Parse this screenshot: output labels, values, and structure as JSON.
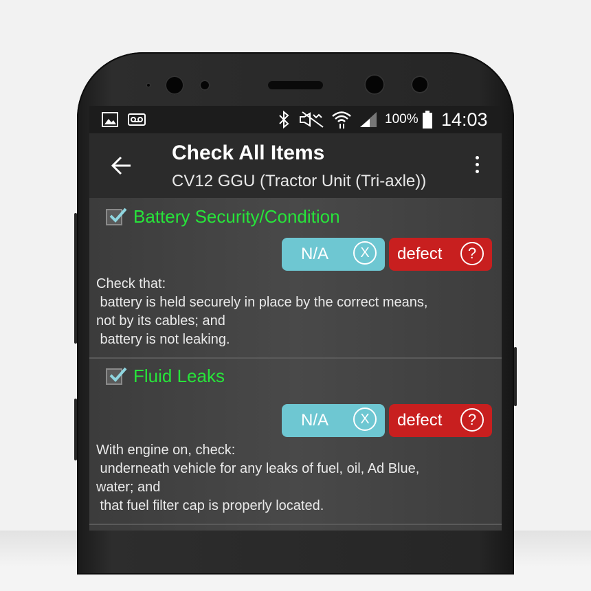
{
  "status_bar": {
    "battery_percent": "100%",
    "time": "14:03",
    "left_icons": [
      "image-icon",
      "voicemail-icon"
    ],
    "right_icons": [
      "bluetooth-icon",
      "mute-icon",
      "wifi-icon",
      "signal-icon",
      "battery-icon"
    ]
  },
  "app_bar": {
    "title": "Check All Items",
    "subtitle": "CV12 GGU (Tractor Unit (Tri-axle))"
  },
  "items": [
    {
      "title": "Battery Security/Condition",
      "checked": true,
      "na_label": "N/A",
      "na_icon_glyph": "X",
      "defect_label": "defect",
      "defect_icon_glyph": "?",
      "description": "Check that:\n battery is held securely in place by the correct means,\nnot by its cables; and\n battery is not leaking."
    },
    {
      "title": "Fluid Leaks",
      "checked": true,
      "na_label": "N/A",
      "na_icon_glyph": "X",
      "defect_label": "defect",
      "defect_icon_glyph": "?",
      "description": "With engine on, check:\n underneath vehicle for any leaks of fuel, oil, Ad Blue,\nwater; and\n that fuel filter cap is properly located."
    }
  ],
  "colors": {
    "title_green": "#27e43a",
    "na_teal": "#6ec7d2",
    "defect_red": "#c81f1f",
    "app_bar": "#2b2b2b",
    "status_bar": "#1c1c1c"
  }
}
